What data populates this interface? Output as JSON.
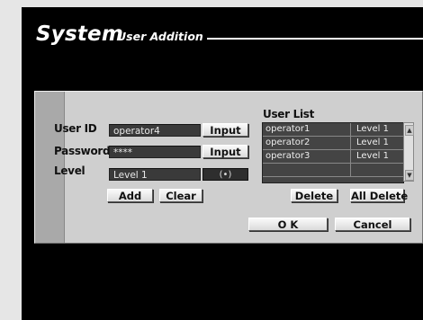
{
  "header": {
    "title": "System",
    "subtitle": "User Addition"
  },
  "form": {
    "user_id": {
      "label": "User ID",
      "value": "operator4",
      "button": "Input"
    },
    "password": {
      "label": "Password",
      "value": "****",
      "button": "Input"
    },
    "level": {
      "label": "Level",
      "value": "Level 1",
      "selector_glyph": "(•)"
    }
  },
  "user_list": {
    "title": "User List",
    "rows": [
      {
        "name": "operator1",
        "level": "Level 1"
      },
      {
        "name": "operator2",
        "level": "Level 1"
      },
      {
        "name": "operator3",
        "level": "Level 1"
      },
      {
        "name": "",
        "level": ""
      }
    ]
  },
  "buttons": {
    "add": "Add",
    "clear": "Clear",
    "delete": "Delete",
    "delete_all": "All Delete",
    "ok": "O K",
    "cancel": "Cancel"
  }
}
